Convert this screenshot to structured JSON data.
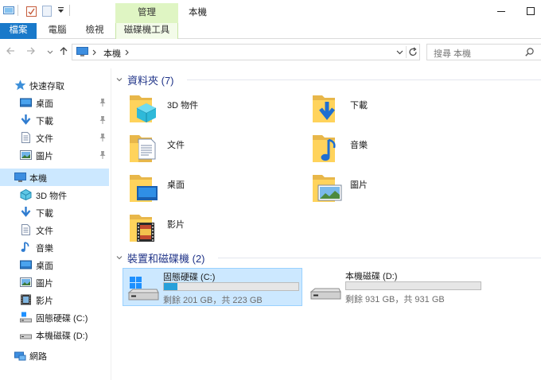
{
  "window": {
    "title": "本機",
    "context_tab_header": "管理"
  },
  "ribbon": {
    "tabs": [
      {
        "label": "檔案"
      },
      {
        "label": "電腦"
      },
      {
        "label": "檢視"
      },
      {
        "label": "磁碟機工具"
      }
    ]
  },
  "address": {
    "location": "本機",
    "search_placeholder": "搜尋 本機"
  },
  "sidebar": {
    "quick_access": "快速存取",
    "quick_items": [
      {
        "label": "桌面",
        "icon": "desktop-icon"
      },
      {
        "label": "下載",
        "icon": "download-icon"
      },
      {
        "label": "文件",
        "icon": "document-icon"
      },
      {
        "label": "圖片",
        "icon": "pictures-icon"
      }
    ],
    "this_pc": "本機",
    "pc_items": [
      {
        "label": "3D 物件",
        "icon": "3d-objects-icon"
      },
      {
        "label": "下載",
        "icon": "download-icon"
      },
      {
        "label": "文件",
        "icon": "document-icon"
      },
      {
        "label": "音樂",
        "icon": "music-icon"
      },
      {
        "label": "桌面",
        "icon": "desktop-icon"
      },
      {
        "label": "圖片",
        "icon": "pictures-icon"
      },
      {
        "label": "影片",
        "icon": "videos-icon"
      },
      {
        "label": "固態硬碟 (C:)",
        "icon": "ssd-drive-icon"
      },
      {
        "label": "本機磁碟 (D:)",
        "icon": "hdd-drive-icon"
      }
    ],
    "network": "網路"
  },
  "folders": {
    "title": "資料夾 (7)",
    "items": [
      {
        "label": "3D 物件"
      },
      {
        "label": "下載"
      },
      {
        "label": "文件"
      },
      {
        "label": "音樂"
      },
      {
        "label": "桌面"
      },
      {
        "label": "圖片"
      },
      {
        "label": "影片"
      }
    ]
  },
  "drives": {
    "title": "裝置和磁碟機 (2)",
    "items": [
      {
        "name": "固態硬碟 (C:)",
        "free_text": "剩餘 201 GB，共 223 GB",
        "used_fraction": 0.099
      },
      {
        "name": "本機磁碟 (D:)",
        "free_text": "剩餘 931 GB，共 931 GB",
        "used_fraction": 0.0
      }
    ]
  },
  "colors": {
    "accent": "#1979ca",
    "selection": "#cce8ff",
    "context_tab": "#dff5c3",
    "group_title": "#1e3287",
    "drive_bar_fill": "#26a0da"
  }
}
